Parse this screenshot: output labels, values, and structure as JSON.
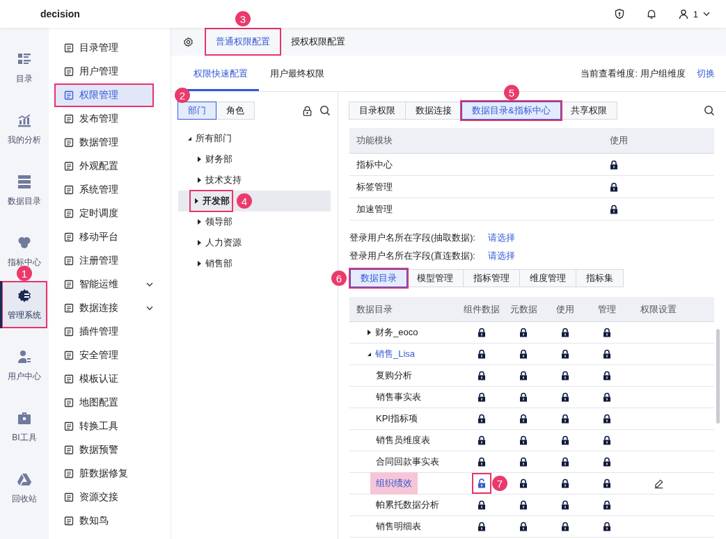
{
  "app": {
    "title": "decision",
    "user": "1"
  },
  "rail": [
    {
      "label": "目录",
      "selected": false
    },
    {
      "label": "我的分析",
      "selected": false
    },
    {
      "label": "数据目录",
      "selected": false
    },
    {
      "label": "指标中心",
      "selected": false
    },
    {
      "label": "管理系统",
      "selected": true,
      "callout": "1"
    },
    {
      "label": "用户中心",
      "selected": false
    },
    {
      "label": "BI工具",
      "selected": false
    },
    {
      "label": "回收站",
      "selected": false
    }
  ],
  "menu": [
    {
      "label": "目录管理",
      "selected": false,
      "expandable": false
    },
    {
      "label": "用户管理",
      "selected": false,
      "expandable": false
    },
    {
      "label": "权限管理",
      "selected": true,
      "expandable": false,
      "callout": "2"
    },
    {
      "label": "发布管理",
      "selected": false,
      "expandable": false
    },
    {
      "label": "数据管理",
      "selected": false,
      "expandable": false
    },
    {
      "label": "外观配置",
      "selected": false,
      "expandable": false
    },
    {
      "label": "系统管理",
      "selected": false,
      "expandable": false
    },
    {
      "label": "定时调度",
      "selected": false,
      "expandable": false
    },
    {
      "label": "移动平台",
      "selected": false,
      "expandable": false
    },
    {
      "label": "注册管理",
      "selected": false,
      "expandable": false
    },
    {
      "label": "智能运维",
      "selected": false,
      "expandable": true
    },
    {
      "label": "数据连接",
      "selected": false,
      "expandable": true
    },
    {
      "label": "插件管理",
      "selected": false,
      "expandable": false
    },
    {
      "label": "安全管理",
      "selected": false,
      "expandable": false
    },
    {
      "label": "模板认证",
      "selected": false,
      "expandable": false
    },
    {
      "label": "地图配置",
      "selected": false,
      "expandable": false
    },
    {
      "label": "转换工具",
      "selected": false,
      "expandable": false
    },
    {
      "label": "数据预警",
      "selected": false,
      "expandable": false
    },
    {
      "label": "脏数据修复",
      "selected": false,
      "expandable": false
    },
    {
      "label": "资源交接",
      "selected": false,
      "expandable": false
    },
    {
      "label": "数知鸟",
      "selected": false,
      "expandable": false
    }
  ],
  "top_tabs": [
    {
      "label": "普通权限配置",
      "selected": true,
      "callout": "3"
    },
    {
      "label": "授权权限配置",
      "selected": false
    }
  ],
  "sub_tabs": [
    {
      "label": "权限快速配置",
      "selected": true
    },
    {
      "label": "用户最终权限",
      "selected": false
    }
  ],
  "dimension": {
    "label": "当前查看维度:",
    "value": "用户组维度",
    "action": "切换"
  },
  "tree_toggle": [
    {
      "label": "部门",
      "selected": true
    },
    {
      "label": "角色",
      "selected": false
    }
  ],
  "tree": {
    "label": "所有部门",
    "expanded": true,
    "children": [
      {
        "label": "财务部",
        "expanded": false,
        "selected": false
      },
      {
        "label": "技术支持",
        "expanded": false,
        "selected": false
      },
      {
        "label": "开发部",
        "expanded": false,
        "selected": true,
        "callout": "4"
      },
      {
        "label": "领导部",
        "expanded": false,
        "selected": false
      },
      {
        "label": "人力资源",
        "expanded": false,
        "selected": false
      },
      {
        "label": "销售部",
        "expanded": false,
        "selected": false
      }
    ]
  },
  "module_tabs": [
    {
      "label": "目录权限",
      "selected": false
    },
    {
      "label": "数据连接",
      "selected": false
    },
    {
      "label": "数据目录&指标中心",
      "selected": true,
      "callout": "5"
    },
    {
      "label": "共享权限",
      "selected": false
    }
  ],
  "module_table": {
    "columns": [
      "功能模块",
      "使用"
    ],
    "rows": [
      {
        "name": "指标中心",
        "locked": true
      },
      {
        "name": "标签管理",
        "locked": true
      },
      {
        "name": "加速管理",
        "locked": true
      }
    ]
  },
  "login_fields": [
    {
      "label": "登录用户名所在字段(抽取数据):",
      "value": "请选择"
    },
    {
      "label": "登录用户名所在字段(直连数据):",
      "value": "请选择"
    }
  ],
  "catalog_tabs": [
    {
      "label": "数据目录",
      "selected": true,
      "callout": "6"
    },
    {
      "label": "模型管理",
      "selected": false
    },
    {
      "label": "指标管理",
      "selected": false
    },
    {
      "label": "维度管理",
      "selected": false
    },
    {
      "label": "指标集",
      "selected": false
    }
  ],
  "catalog_table": {
    "columns": [
      "数据目录",
      "组件数据",
      "元数据",
      "使用",
      "管理",
      "权限设置"
    ],
    "rows": [
      {
        "name": "财务_eoco",
        "kind": "folder",
        "expanded": false,
        "selected": false,
        "editable": false,
        "cells": [
          {
            "locked": true
          },
          {
            "locked": true
          },
          {
            "locked": true
          },
          {
            "locked": true
          }
        ]
      },
      {
        "name": "销售_Lisa",
        "kind": "folder",
        "expanded": true,
        "selected": false,
        "editable": false,
        "cells": [
          {
            "locked": true
          },
          {
            "locked": true
          },
          {
            "locked": true
          },
          {
            "locked": true
          }
        ]
      },
      {
        "name": "复购分析",
        "kind": "item",
        "selected": false,
        "editable": false,
        "cells": [
          {
            "locked": true
          },
          {
            "locked": true
          },
          {
            "locked": true
          },
          {
            "locked": true
          }
        ]
      },
      {
        "name": "销售事实表",
        "kind": "item",
        "selected": false,
        "editable": false,
        "cells": [
          {
            "locked": true
          },
          {
            "locked": true
          },
          {
            "locked": true
          },
          {
            "locked": true
          }
        ]
      },
      {
        "name": "KPI指标项",
        "kind": "item",
        "selected": false,
        "editable": false,
        "cells": [
          {
            "locked": true
          },
          {
            "locked": true
          },
          {
            "locked": true
          },
          {
            "locked": true
          }
        ]
      },
      {
        "name": "销售员维度表",
        "kind": "item",
        "selected": false,
        "editable": false,
        "cells": [
          {
            "locked": true
          },
          {
            "locked": true
          },
          {
            "locked": true
          },
          {
            "locked": true
          }
        ]
      },
      {
        "name": "合同回款事实表",
        "kind": "item",
        "selected": false,
        "editable": false,
        "cells": [
          {
            "locked": true
          },
          {
            "locked": true
          },
          {
            "locked": true
          },
          {
            "locked": true
          }
        ]
      },
      {
        "name": "组织绩效",
        "kind": "item",
        "selected": true,
        "editable": true,
        "cells": [
          {
            "locked": false,
            "callout": "7"
          },
          {
            "locked": true
          },
          {
            "locked": true
          },
          {
            "locked": true
          }
        ]
      },
      {
        "name": "帕累托数据分析",
        "kind": "item",
        "selected": false,
        "editable": false,
        "cells": [
          {
            "locked": true
          },
          {
            "locked": true
          },
          {
            "locked": true
          },
          {
            "locked": true
          }
        ]
      },
      {
        "name": "销售明细表",
        "kind": "item",
        "selected": false,
        "editable": false,
        "cells": [
          {
            "locked": true
          },
          {
            "locked": true
          },
          {
            "locked": true
          },
          {
            "locked": true
          }
        ]
      }
    ]
  }
}
